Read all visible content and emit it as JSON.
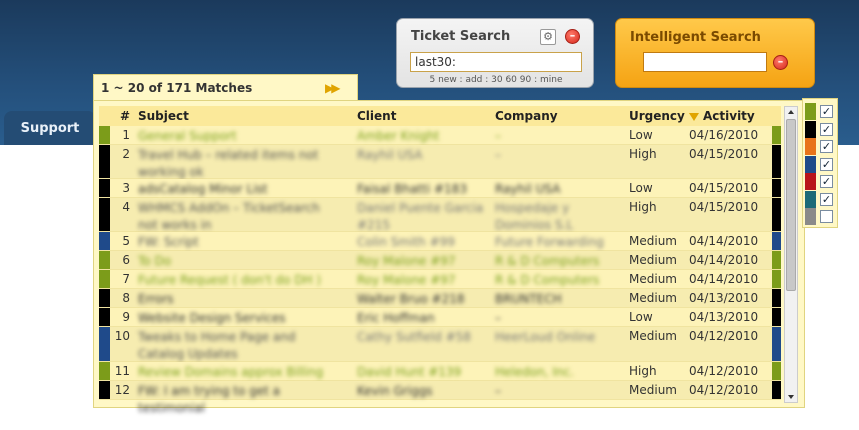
{
  "nav": {
    "support_tab": "Support"
  },
  "ticket_search": {
    "title": "Ticket Search",
    "value": "last30:",
    "hint": "5 new : add : 30 60 90 : mine"
  },
  "intelligent_search": {
    "title": "Intelligent Search",
    "value": ""
  },
  "results": {
    "summary": "1 ~ 20 of 171 Matches",
    "headers": {
      "num": "#",
      "subject": "Subject",
      "client": "Client",
      "company": "Company",
      "urgency": "Urgency",
      "activity": "Activity"
    },
    "rows": [
      {
        "num": "1",
        "subject": "General Support",
        "client": "Amber Knight",
        "company": "–",
        "urgency": "Low",
        "activity": "04/16/2010",
        "color": "#7c9c1a",
        "style": "green"
      },
      {
        "num": "2",
        "subject": "Travel Hub – related items not working ok",
        "client": "Rayhil USA",
        "company": "–",
        "urgency": "High",
        "activity": "04/15/2010",
        "color": "#000000",
        "style": "normal"
      },
      {
        "num": "3",
        "subject": "adsCatalog Minor List",
        "client": "Faisal Bhatti #183",
        "company": "Rayhil USA",
        "urgency": "Low",
        "activity": "04/15/2010",
        "color": "#000000",
        "style": "dark"
      },
      {
        "num": "4",
        "subject": "WHMCS AddOn – TicketSearch not works in",
        "client": "Daniel Puente Garcia #215",
        "company": "Hospedaje y Dominios S.L",
        "urgency": "High",
        "activity": "04/15/2010",
        "color": "#000000",
        "style": "normal"
      },
      {
        "num": "5",
        "subject": "FW: Script",
        "client": "Colin Smith #99",
        "company": "Future Forwarding",
        "urgency": "Medium",
        "activity": "04/14/2010",
        "color": "#1f4a8a",
        "style": "normal"
      },
      {
        "num": "6",
        "subject": "To Do",
        "client": "Roy Malone #97",
        "company": "R & D Computers",
        "urgency": "Medium",
        "activity": "04/14/2010",
        "color": "#7c9c1a",
        "style": "green"
      },
      {
        "num": "7",
        "subject": "Future Request ( don't do DH )",
        "client": "Roy Malone #97",
        "company": "R & D Computers",
        "urgency": "Medium",
        "activity": "04/14/2010",
        "color": "#7c9c1a",
        "style": "green"
      },
      {
        "num": "8",
        "subject": "Errors",
        "client": "Walter Bruo #218",
        "company": "BRUNTECH",
        "urgency": "Medium",
        "activity": "04/13/2010",
        "color": "#000000",
        "style": "dark"
      },
      {
        "num": "9",
        "subject": "Website Design Services",
        "client": "Eric Hoffman",
        "company": "–",
        "urgency": "Low",
        "activity": "04/13/2010",
        "color": "#000000",
        "style": "dark"
      },
      {
        "num": "10",
        "subject": "Tweaks to Home Page and Catalog Updates",
        "client": "Cathy Sutfield #58",
        "company": "HeerLoud Online",
        "urgency": "Medium",
        "activity": "04/12/2010",
        "color": "#1f4a8a",
        "style": "normal"
      },
      {
        "num": "11",
        "subject": "Review Domains approx Billing",
        "client": "David Hunt #139",
        "company": "Heledon, Inc.",
        "urgency": "High",
        "activity": "04/12/2010",
        "color": "#7c9c1a",
        "style": "green"
      },
      {
        "num": "12",
        "subject": "FW: I am trying to get a testimonial",
        "client": "Kevin Griggs",
        "company": "–",
        "urgency": "Medium",
        "activity": "04/12/2010",
        "color": "#000000",
        "style": "dark"
      }
    ]
  },
  "filters": [
    {
      "color": "#7c9c1a",
      "checked": true,
      "mark": "✓"
    },
    {
      "color": "#000000",
      "checked": true,
      "mark": "✓"
    },
    {
      "color": "#e8731a",
      "checked": true,
      "mark": "✓"
    },
    {
      "color": "#1f4a8a",
      "checked": true,
      "mark": "✓"
    },
    {
      "color": "#b8141a",
      "checked": true,
      "mark": "✓"
    },
    {
      "color": "#1c6a78",
      "checked": true,
      "mark": "✓"
    },
    {
      "color": "#8a8a8a",
      "checked": false,
      "mark": ""
    }
  ]
}
